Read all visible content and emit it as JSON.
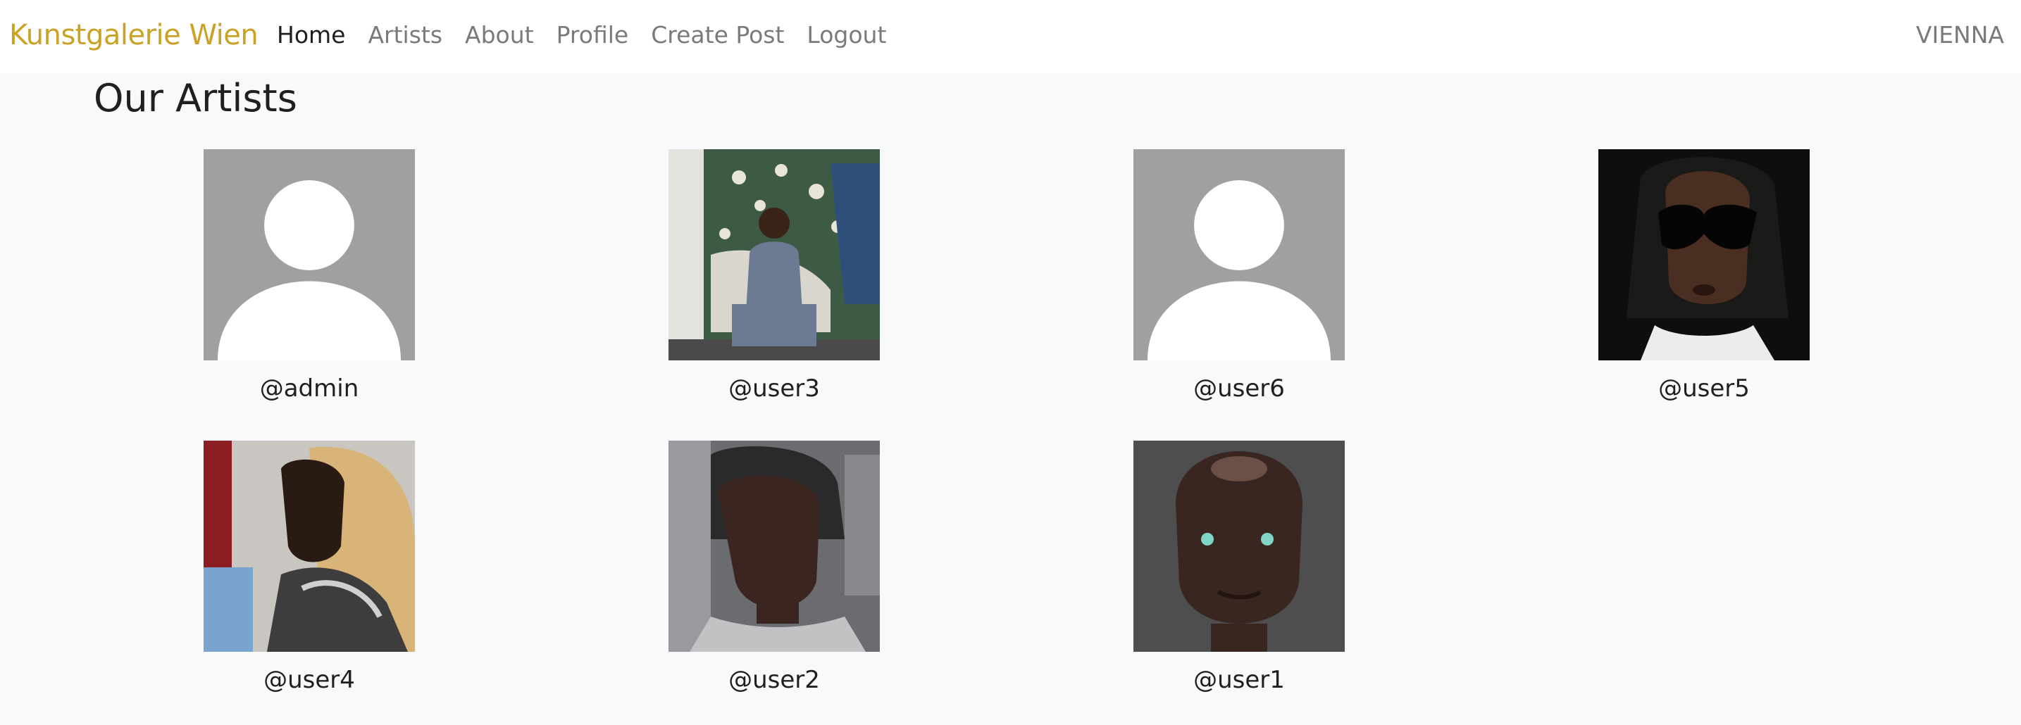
{
  "navbar": {
    "brand": "Kunstgalerie Wien",
    "links": [
      {
        "label": "Home",
        "active": true
      },
      {
        "label": "Artists",
        "active": false
      },
      {
        "label": "About",
        "active": false
      },
      {
        "label": "Profile",
        "active": false
      },
      {
        "label": "Create Post",
        "active": false
      },
      {
        "label": "Logout",
        "active": false
      }
    ],
    "city": "VIENNA"
  },
  "page": {
    "title": "Our Artists"
  },
  "artists": [
    {
      "username": "@admin",
      "avatar": "default-avatar-icon"
    },
    {
      "username": "@user3",
      "avatar": "artist-photo"
    },
    {
      "username": "@user6",
      "avatar": "default-avatar-icon"
    },
    {
      "username": "@user5",
      "avatar": "artist-photo"
    },
    {
      "username": "@user4",
      "avatar": "artist-photo"
    },
    {
      "username": "@user2",
      "avatar": "artist-photo"
    },
    {
      "username": "@user1",
      "avatar": "artist-photo"
    }
  ],
  "colors": {
    "brand": "#c9a227",
    "background": "#f8f9fa",
    "navbar": "#ffffff",
    "default_avatar_bg": "#a0a0a0"
  }
}
